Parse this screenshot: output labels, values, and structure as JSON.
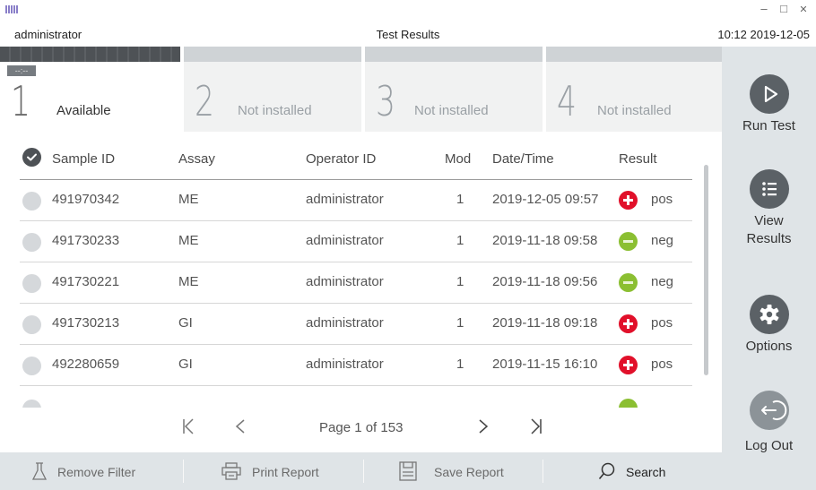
{
  "window": {
    "user": "administrator",
    "title": "Test Results",
    "clock": "10:12 2019-12-05",
    "controls": {
      "minimize": "–",
      "maximize": "□",
      "close": "✕"
    }
  },
  "tabs": [
    {
      "number": "1",
      "label": "Available",
      "indicator": "--:--",
      "active": true
    },
    {
      "number": "2",
      "label": "Not installed",
      "active": false
    },
    {
      "number": "3",
      "label": "Not installed",
      "active": false
    },
    {
      "number": "4",
      "label": "Not installed",
      "active": false
    }
  ],
  "sidebar": {
    "run_test": "Run Test",
    "view_results": "View Results",
    "options": "Options",
    "log_out": "Log Out"
  },
  "table": {
    "headers": {
      "sample_id": "Sample ID",
      "assay": "Assay",
      "operator_id": "Operator ID",
      "mod": "Mod",
      "date_time": "Date/Time",
      "result": "Result"
    },
    "rows": [
      {
        "sample_id": "491970342",
        "assay": "ME",
        "operator_id": "administrator",
        "mod": "1",
        "date_time": "2019-12-05 09:57",
        "result": "pos",
        "result_icon": "plus-icon",
        "result_color": "#e1102a"
      },
      {
        "sample_id": "491730233",
        "assay": "ME",
        "operator_id": "administrator",
        "mod": "1",
        "date_time": "2019-11-18 09:58",
        "result": "neg",
        "result_icon": "minus-icon",
        "result_color": "#8bbf32"
      },
      {
        "sample_id": "491730221",
        "assay": "ME",
        "operator_id": "administrator",
        "mod": "1",
        "date_time": "2019-11-18 09:56",
        "result": "neg",
        "result_icon": "minus-icon",
        "result_color": "#8bbf32"
      },
      {
        "sample_id": "491730213",
        "assay": "GI",
        "operator_id": "administrator",
        "mod": "1",
        "date_time": "2019-11-18 09:18",
        "result": "pos",
        "result_icon": "plus-icon",
        "result_color": "#e1102a"
      },
      {
        "sample_id": "492280659",
        "assay": "GI",
        "operator_id": "administrator",
        "mod": "1",
        "date_time": "2019-11-15 16:10",
        "result": "pos",
        "result_icon": "plus-icon",
        "result_color": "#e1102a"
      }
    ]
  },
  "pagination": {
    "page_text": "Page 1 of 153",
    "first": "K",
    "prev": "<",
    "next": ">",
    "last": ">|"
  },
  "toolbar": {
    "remove_filter": "Remove Filter",
    "print_report": "Print Report",
    "save_report": "Save Report",
    "search": "Search"
  },
  "colors": {
    "positive": "#e1102a",
    "negative": "#8bbf32",
    "sidebar_bg": "#dfe4e7",
    "icon_dark": "#5b6166"
  }
}
